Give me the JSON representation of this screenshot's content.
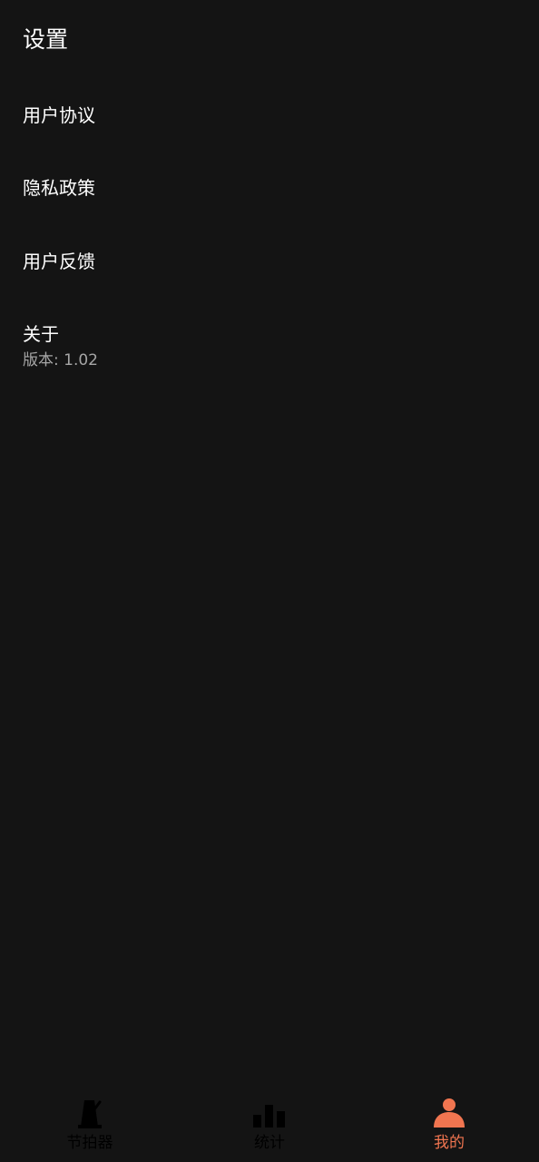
{
  "page": {
    "title": "设置"
  },
  "menu": {
    "items": [
      {
        "label": "用户协议"
      },
      {
        "label": "隐私政策"
      },
      {
        "label": "用户反馈"
      },
      {
        "label": "关于",
        "sub": "版本: 1.02"
      }
    ]
  },
  "tabbar": {
    "tabs": [
      {
        "label": "节拍器",
        "icon": "metronome-icon",
        "active": false
      },
      {
        "label": "统计",
        "icon": "bar-chart-icon",
        "active": false
      },
      {
        "label": "我的",
        "icon": "person-icon",
        "active": true
      }
    ]
  },
  "colors": {
    "background": "#141414",
    "text": "#ffffff",
    "subtext": "#a6a6a6",
    "accent": "#f07550",
    "tab_inactive": "#000000"
  }
}
